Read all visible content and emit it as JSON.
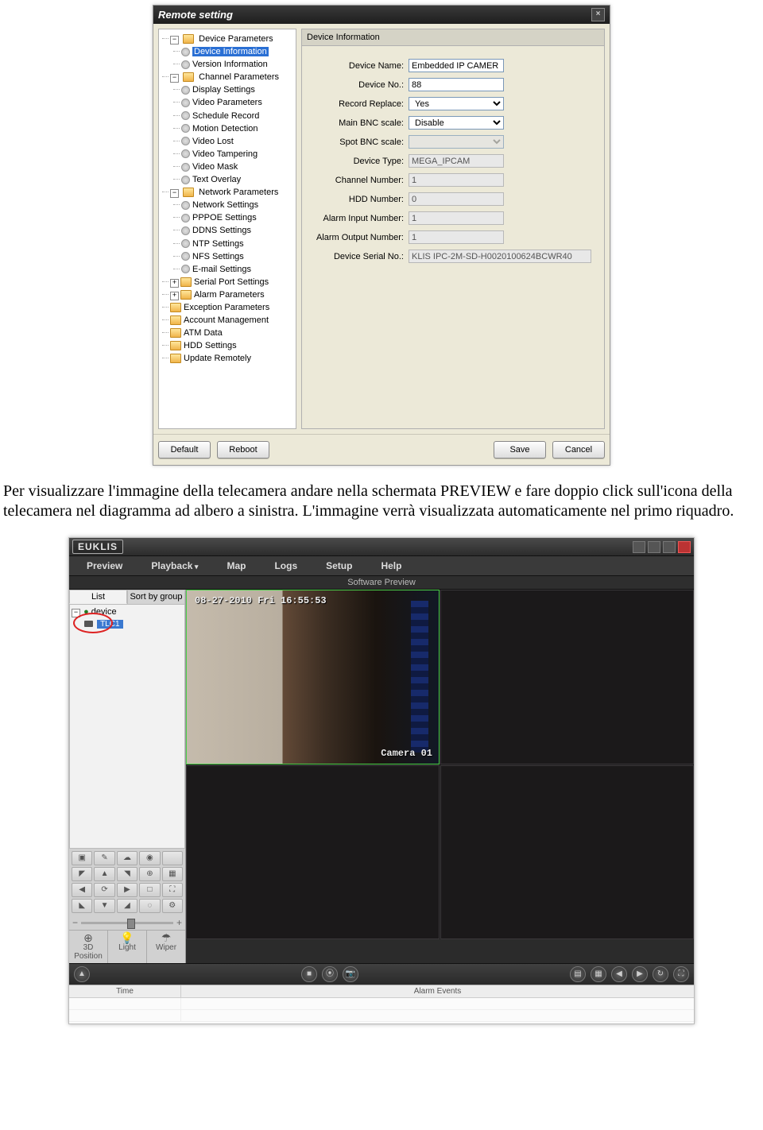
{
  "dialog1": {
    "title": "Remote setting",
    "tree": {
      "device_params": "Device Parameters",
      "device_info": "Device Information",
      "version_info": "Version Information",
      "channel_params": "Channel Parameters",
      "display_settings": "Display Settings",
      "video_parameters": "Video Parameters",
      "schedule_record": "Schedule Record",
      "motion_detection": "Motion Detection",
      "video_lost": "Video Lost",
      "video_tampering": "Video Tampering",
      "video_mask": "Video Mask",
      "text_overlay": "Text Overlay",
      "network_params": "Network Parameters",
      "network_settings": "Network Settings",
      "pppoe_settings": "PPPOE Settings",
      "ddns_settings": "DDNS Settings",
      "ntp_settings": "NTP Settings",
      "nfs_settings": "NFS Settings",
      "email_settings": "E-mail Settings",
      "serial_port_settings": "Serial Port Settings",
      "alarm_parameters": "Alarm Parameters",
      "exception_parameters": "Exception Parameters",
      "account_management": "Account Management",
      "atm_data": "ATM Data",
      "hdd_settings": "HDD Settings",
      "update_remotely": "Update Remotely"
    },
    "panel_title": "Device Information",
    "form": {
      "device_name_label": "Device Name:",
      "device_name_value": "Embedded IP CAMER",
      "device_no_label": "Device No.:",
      "device_no_value": "88",
      "record_replace_label": "Record Replace:",
      "record_replace_value": "Yes",
      "main_bnc_label": "Main BNC scale:",
      "main_bnc_value": "Disable",
      "spot_bnc_label": "Spot BNC scale:",
      "spot_bnc_value": "",
      "device_type_label": "Device Type:",
      "device_type_value": "MEGA_IPCAM",
      "channel_number_label": "Channel Number:",
      "channel_number_value": "1",
      "hdd_number_label": "HDD Number:",
      "hdd_number_value": "0",
      "alarm_input_label": "Alarm Input Number:",
      "alarm_input_value": "1",
      "alarm_output_label": "Alarm Output Number:",
      "alarm_output_value": "1",
      "device_serial_label": "Device Serial No.:",
      "device_serial_value": "KLIS IPC-2M-SD-H0020100624BCWR40"
    },
    "buttons": {
      "default": "Default",
      "reboot": "Reboot",
      "save": "Save",
      "cancel": "Cancel"
    },
    "toggle_minus": "−",
    "toggle_plus": "+"
  },
  "paragraph": "Per visualizzare l'immagine della telecamera andare nella schermata PREVIEW e fare doppio click sull'icona della telecamera nel diagramma ad albero a sinistra. L'immagine verrà visualizzata automaticamente nel primo riquadro.",
  "app2": {
    "brand": "EUKLIS",
    "menu": {
      "preview": "Preview",
      "playback": "Playback",
      "map": "Map",
      "logs": "Logs",
      "setup": "Setup",
      "help": "Help"
    },
    "sub_header": "Software Preview",
    "side_tabs": {
      "list": "List",
      "sort": "Sort by group"
    },
    "tree": {
      "root": "device",
      "cam": "TLC1"
    },
    "ptz_buttons": {
      "3d": "3D Position",
      "light": "Light",
      "wiper": "Wiper"
    },
    "slider": {
      "minus": "−",
      "plus": "+"
    },
    "osd": {
      "time": "08-27-2010 Fri 16:55:53",
      "cam_name": "Camera 01"
    },
    "events": {
      "time_col": "Time",
      "events_col": "Alarm Events"
    }
  }
}
